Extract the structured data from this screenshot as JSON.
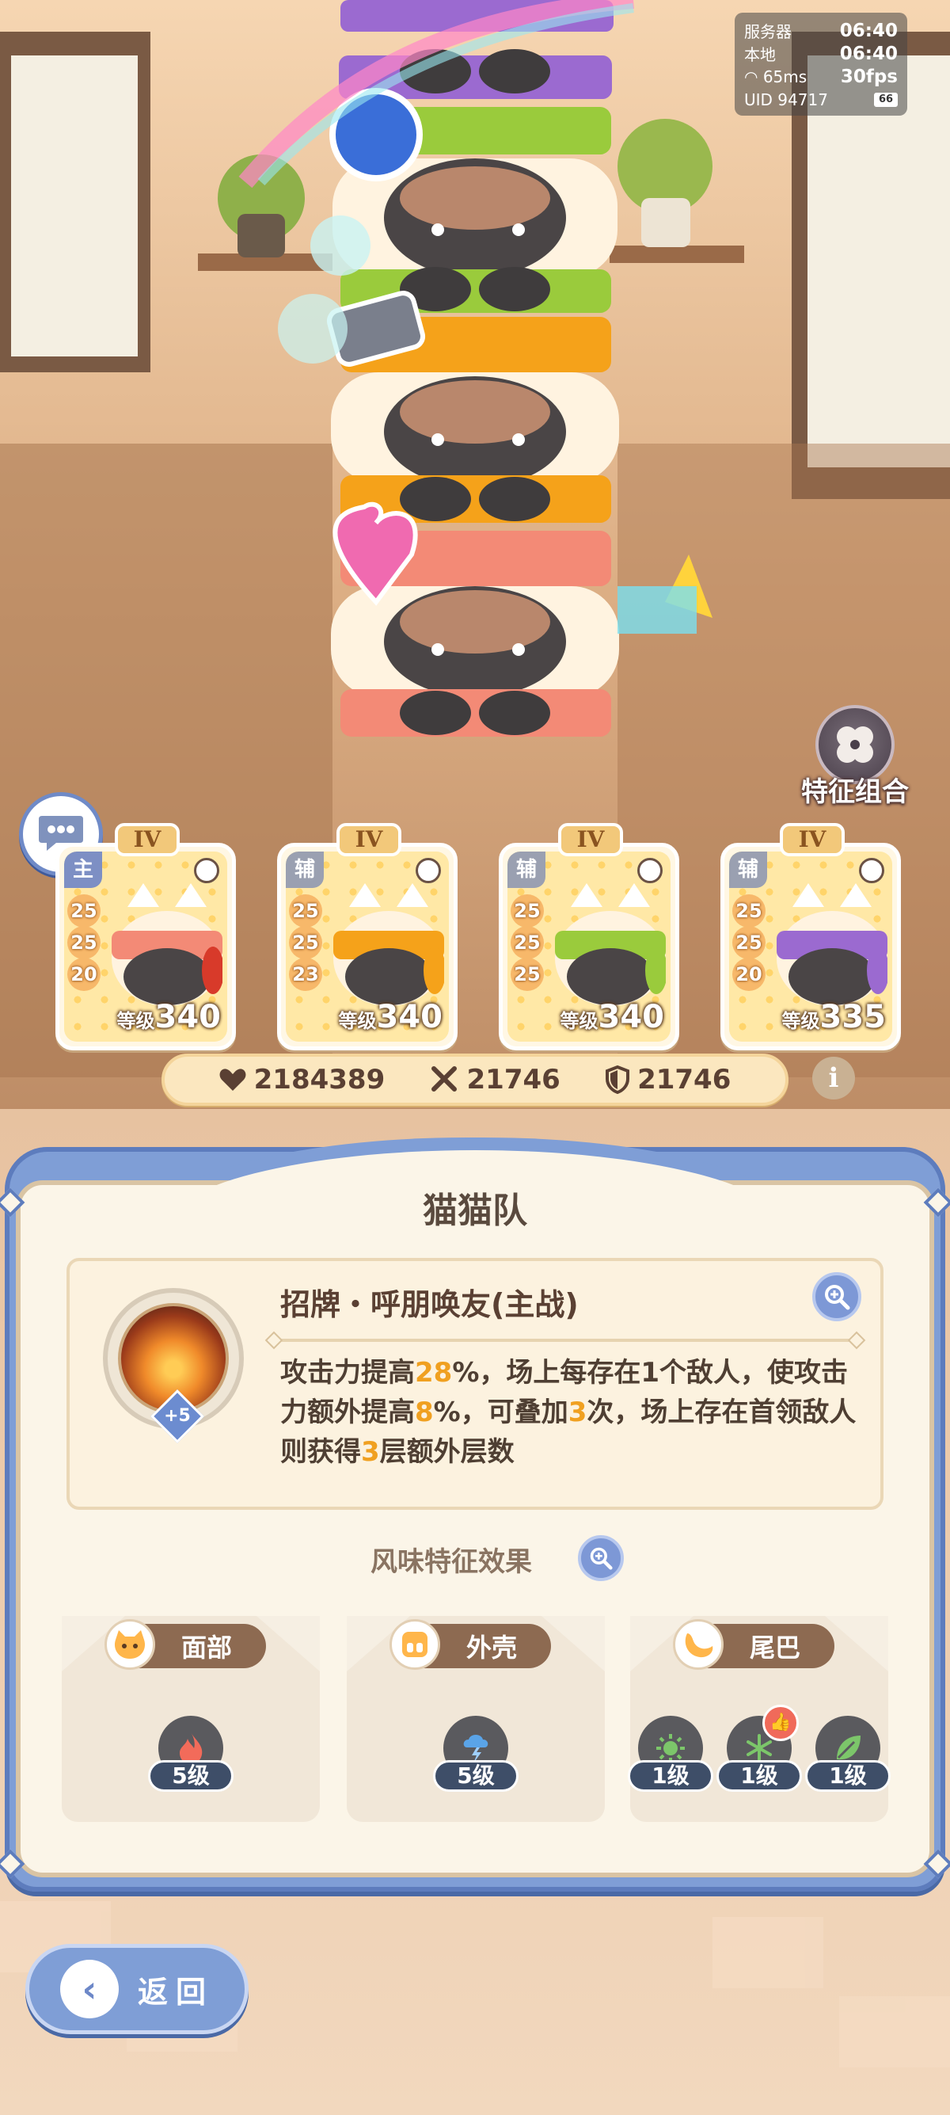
{
  "status": {
    "server_label": "服务器",
    "server_time": "06:40",
    "local_label": "本地",
    "local_time": "06:40",
    "ping": "65ms",
    "fps": "30fps",
    "uid_label": "UID",
    "uid": "94717",
    "battery": "66"
  },
  "trait_combo_label": "特征组合",
  "cards": [
    {
      "rank": "IV",
      "role": "主",
      "stats": [
        "25",
        "25",
        "20"
      ],
      "level_prefix": "等级",
      "level": "340"
    },
    {
      "rank": "IV",
      "role": "辅",
      "stats": [
        "25",
        "25",
        "23"
      ],
      "level_prefix": "等级",
      "level": "340"
    },
    {
      "rank": "IV",
      "role": "辅",
      "stats": [
        "25",
        "25",
        "25"
      ],
      "level_prefix": "等级",
      "level": "340"
    },
    {
      "rank": "IV",
      "role": "辅",
      "stats": [
        "25",
        "25",
        "20"
      ],
      "level_prefix": "等级",
      "level": "335"
    }
  ],
  "totals": {
    "hp": "2184389",
    "attack": "21746",
    "defense": "21746"
  },
  "info_label": "i",
  "team": {
    "name": "猫猫队",
    "skill": {
      "plus": "+5",
      "name": "招牌・呼朋唤友(主战)",
      "desc": {
        "p1": "攻击力提高",
        "v1": "28",
        "p2": "%，场上每存在1个敌人，使攻击力额外提高",
        "v2": "8",
        "p3": "%，可叠加",
        "v3": "3",
        "p4": "次，场上存在首领敌人则获得",
        "v4": "3",
        "p5": "层额外层数"
      }
    },
    "flavor_title": "风味特征效果",
    "traits": [
      {
        "name": "面部",
        "elements": [
          {
            "level": "5级",
            "icon": "fire-icon",
            "color": "#f26b5a"
          }
        ]
      },
      {
        "name": "外壳",
        "elements": [
          {
            "level": "5级",
            "icon": "storm-icon",
            "color": "#5aa4e8"
          }
        ]
      },
      {
        "name": "尾巴",
        "elements": [
          {
            "level": "1级",
            "icon": "sun-icon",
            "color": "#7cc66a"
          },
          {
            "level": "1级",
            "icon": "snowflake-icon",
            "color": "#7cc66a"
          },
          {
            "level": "1级",
            "icon": "leaf-icon",
            "color": "#7cc66a"
          }
        ]
      }
    ]
  },
  "back_label": "返回"
}
